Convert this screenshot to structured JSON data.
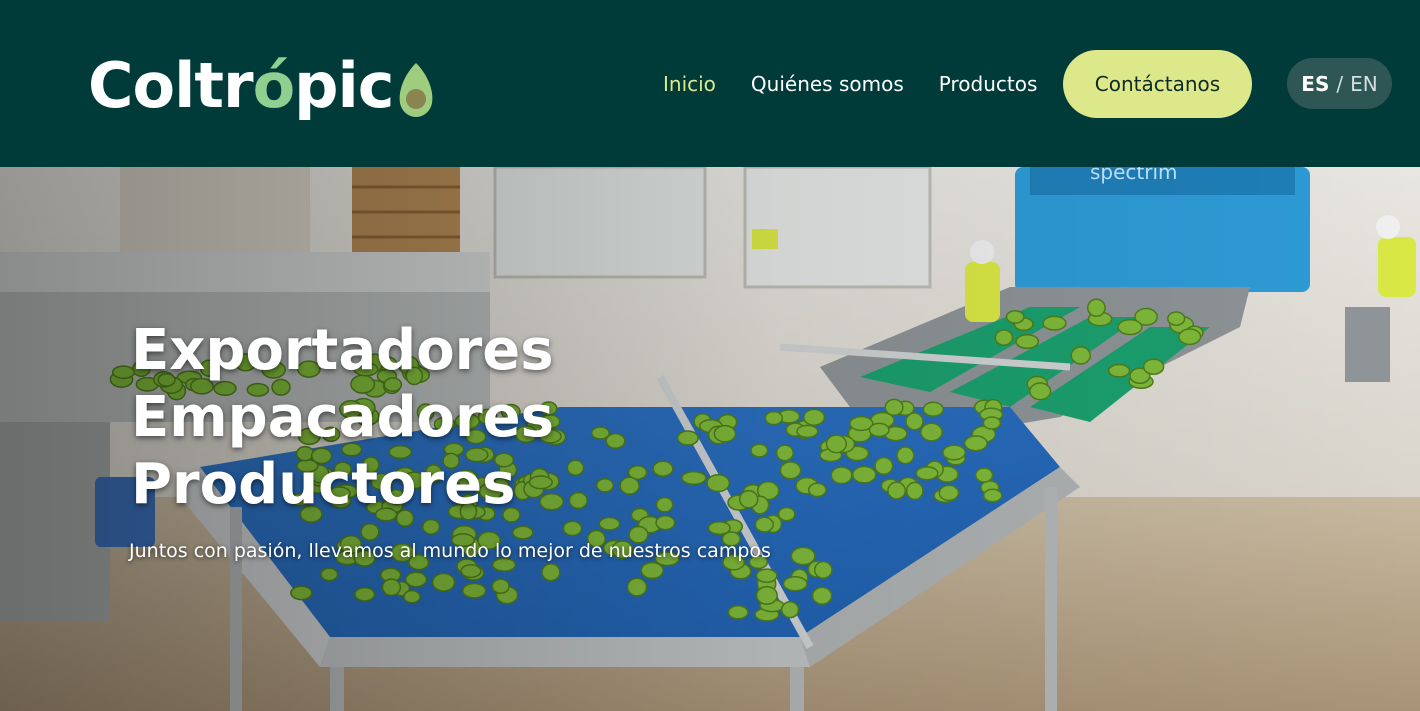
{
  "brand": {
    "name_part1": "Coltr",
    "name_accent": "ó",
    "name_part2": "pic",
    "logo_icon": "avocado-icon"
  },
  "nav": {
    "items": [
      {
        "label": "Inicio",
        "active": true
      },
      {
        "label": "Quiénes somos",
        "active": false
      },
      {
        "label": "Productos",
        "active": false
      }
    ],
    "cta_label": "Contáctanos"
  },
  "language": {
    "current": "ES",
    "separator": "/",
    "other": "EN"
  },
  "hero": {
    "lines": [
      "Exportadores",
      "Empacadores",
      "Productores"
    ],
    "subtitle": "Juntos con pasión, llevamos al mundo lo mejor de nuestros campos",
    "machine_label": "spectrim"
  },
  "colors": {
    "header_bg": "#003b3a",
    "accent": "#dde88a",
    "active_link": "#dbe88b",
    "lang_pill": "#2e5655"
  }
}
